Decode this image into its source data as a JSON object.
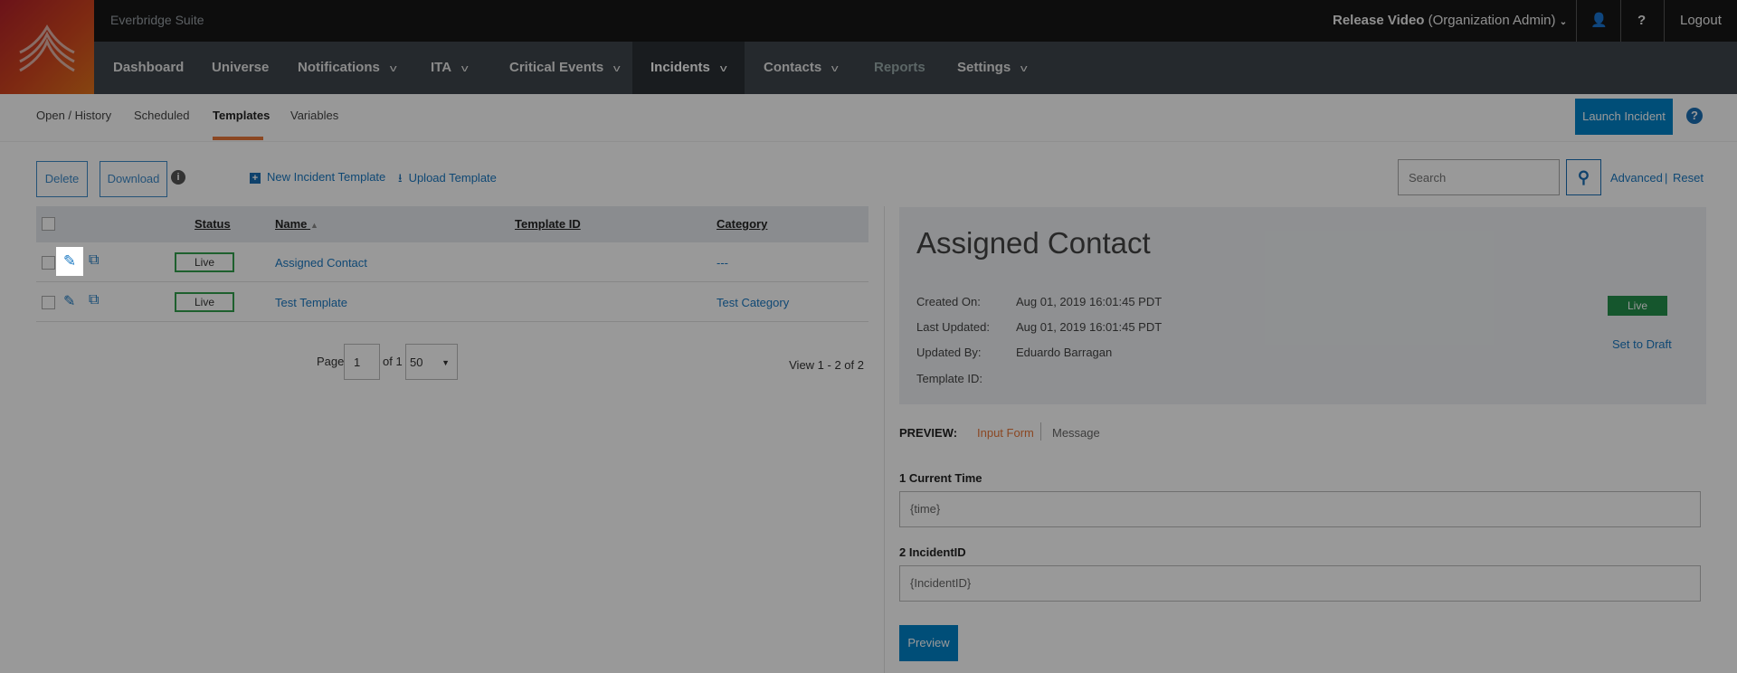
{
  "header": {
    "suite": "Everbridge Suite",
    "user": "Release Video",
    "role": "(Organization Admin)",
    "logout": "Logout",
    "help": "?"
  },
  "nav": [
    {
      "label": "Dashboard"
    },
    {
      "label": "Universe"
    },
    {
      "label": "Notifications",
      "dropdown": true
    },
    {
      "label": "ITA",
      "dropdown": true
    },
    {
      "label": "Critical Events",
      "dropdown": true
    },
    {
      "label": "Incidents",
      "dropdown": true,
      "active": true
    },
    {
      "label": "Contacts",
      "dropdown": true
    },
    {
      "label": "Reports",
      "disabled": true
    },
    {
      "label": "Settings",
      "dropdown": true
    }
  ],
  "subnav": {
    "tabs": [
      "Open / History",
      "Scheduled",
      "Templates",
      "Variables"
    ],
    "active": "Templates",
    "launch": "Launch Incident"
  },
  "toolbar": {
    "delete": "Delete",
    "download": "Download",
    "new_template": "New Incident Template",
    "upload": "Upload Template",
    "search_placeholder": "Search",
    "advanced": "Advanced",
    "divider": "|",
    "reset": "Reset"
  },
  "table": {
    "columns": [
      "Status",
      "Name",
      "Template ID",
      "Category"
    ],
    "rows": [
      {
        "status": "Live",
        "name": "Assigned Contact",
        "template_id": "",
        "category": "---"
      },
      {
        "status": "Live",
        "name": "Test Template",
        "template_id": "",
        "category": "Test Category"
      }
    ]
  },
  "pagination": {
    "page_label": "Page",
    "page": "1",
    "of": "of 1",
    "page_size": "50",
    "view": "View 1 - 2 of 2"
  },
  "detail": {
    "title": "Assigned Contact",
    "fields": [
      {
        "label": "Created On:",
        "value": "Aug 01, 2019 16:01:45 PDT"
      },
      {
        "label": "Last Updated:",
        "value": "Aug 01, 2019 16:01:45 PDT"
      },
      {
        "label": "Updated By:",
        "value": "Eduardo Barragan"
      },
      {
        "label": "Template ID:",
        "value": ""
      }
    ],
    "status": "Live",
    "set_draft": "Set to Draft"
  },
  "preview": {
    "label": "PREVIEW:",
    "tabs": [
      "Input Form",
      "Message"
    ],
    "active": "Input Form",
    "fields": [
      {
        "label": "1 Current Time",
        "value": "{time}"
      },
      {
        "label": "2 IncidentID",
        "value": "{IncidentID}"
      }
    ],
    "button": "Preview"
  },
  "colors": {
    "accent": "#e8773a",
    "brand_blue": "#0082c8",
    "live_green": "#33a04d"
  }
}
